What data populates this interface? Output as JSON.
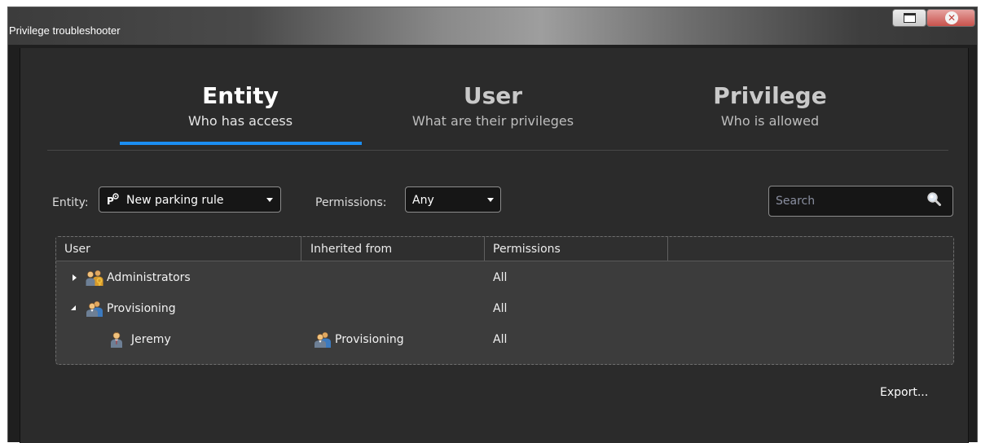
{
  "window": {
    "title": "Privilege troubleshooter"
  },
  "tabs": [
    {
      "title": "Entity",
      "subtitle": "Who has access",
      "active": true
    },
    {
      "title": "User",
      "subtitle": "What are their privileges",
      "active": false
    },
    {
      "title": "Privilege",
      "subtitle": "Who is allowed",
      "active": false
    }
  ],
  "filters": {
    "entity_label": "Entity:",
    "entity_value": "New parking rule",
    "entity_icon": "parking-rule-icon",
    "permissions_label": "Permissions:",
    "permissions_value": "Any"
  },
  "search": {
    "placeholder": "Search",
    "value": ""
  },
  "table": {
    "columns": [
      "User",
      "Inherited from",
      "Permissions",
      ""
    ],
    "rows": [
      {
        "user": "Administrators",
        "user_icon": "admin-group-icon",
        "expander": "collapsed",
        "inherited_from": "",
        "inherited_icon": "",
        "permissions": "All"
      },
      {
        "user": "Provisioning",
        "user_icon": "user-group-icon",
        "expander": "expanded",
        "inherited_from": "",
        "inherited_icon": "",
        "permissions": "All"
      },
      {
        "user": "Jeremy",
        "user_icon": "user-icon",
        "expander": "",
        "inherited_from": "Provisioning",
        "inherited_icon": "user-group-icon",
        "permissions": "All"
      }
    ]
  },
  "actions": {
    "export_label": "Export..."
  },
  "colors": {
    "accent": "#1b8ef2",
    "background": "#2b2b2b",
    "grid_background": "#3c3c3c",
    "close_button": "#c8524c"
  }
}
